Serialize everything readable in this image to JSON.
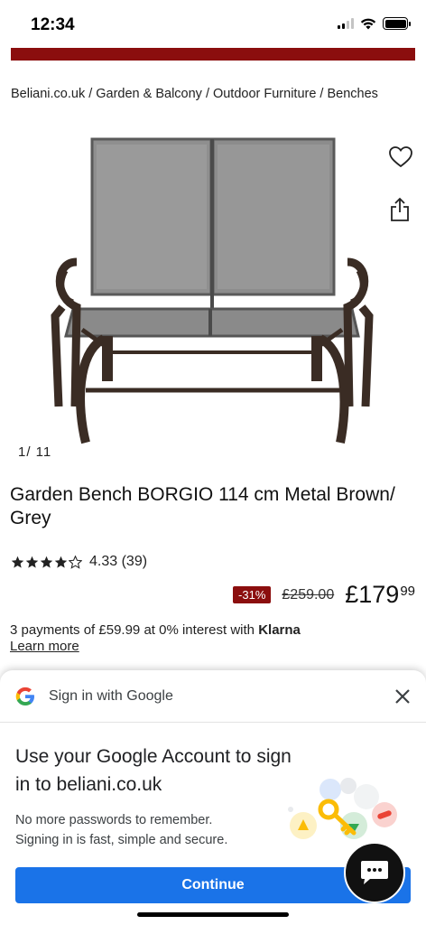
{
  "status_bar": {
    "time": "12:34"
  },
  "breadcrumb": {
    "items": [
      "Beliani.co.uk",
      "Garden & Balcony",
      "Outdoor Furniture",
      "Benches"
    ],
    "separator": "/"
  },
  "gallery": {
    "counter": "1/ 11"
  },
  "product": {
    "title": "Garden Bench BORGIO 114 cm Metal Brown/ Grey",
    "rating": {
      "value": "4.33",
      "count": "(39)",
      "stars_filled": 4.33,
      "stars_total": 5
    },
    "price": {
      "discount": "-31%",
      "old_price": "£259.00",
      "new_price_main": "£179",
      "new_price_cents": "99"
    },
    "klarna": {
      "prefix": "3 payments of ",
      "amount": "£59.99",
      "middle": " at 0% interest with ",
      "brand": "Klarna",
      "learn_more": "Learn more"
    }
  },
  "google_sheet": {
    "header_title": "Sign in with Google",
    "heading": "Use your Google Account to sign in to beliani.co.uk",
    "body_line1": "No more passwords to remember.",
    "body_line2": "Signing in is fast, simple and secure.",
    "continue_label": "Continue"
  },
  "icons": {
    "wishlist": "heart-icon",
    "share": "share-icon",
    "close": "close-icon",
    "chat": "chat-icon"
  },
  "colors": {
    "brand_red": "#8b0e0e",
    "google_blue": "#1a73e8"
  }
}
